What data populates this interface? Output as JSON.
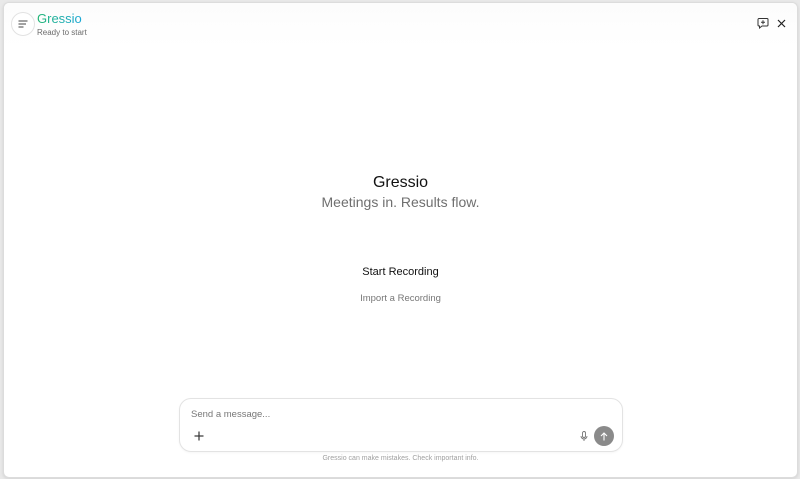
{
  "app": {
    "title": "Gressio",
    "status": "Ready to start"
  },
  "header": {
    "menu_icon": "menu-lines-icon",
    "new_chat_icon": "new-chat-icon",
    "close_icon": "close-icon"
  },
  "hero": {
    "title": "Gressio",
    "subtitle": "Meetings in. Results flow."
  },
  "actions": {
    "start_recording": "Start Recording",
    "import_recording": "Import a Recording"
  },
  "composer": {
    "placeholder": "Send a message...",
    "value": "",
    "attach_icon": "plus-icon",
    "mic_icon": "microphone-icon",
    "send_icon": "arrow-up-icon"
  },
  "disclaimer": "Gressio can make mistakes. Check important info.",
  "colors": {
    "title_gradient_start": "#22b573",
    "title_gradient_end": "#1aa7d8",
    "send_button": "#8a8a8a"
  }
}
